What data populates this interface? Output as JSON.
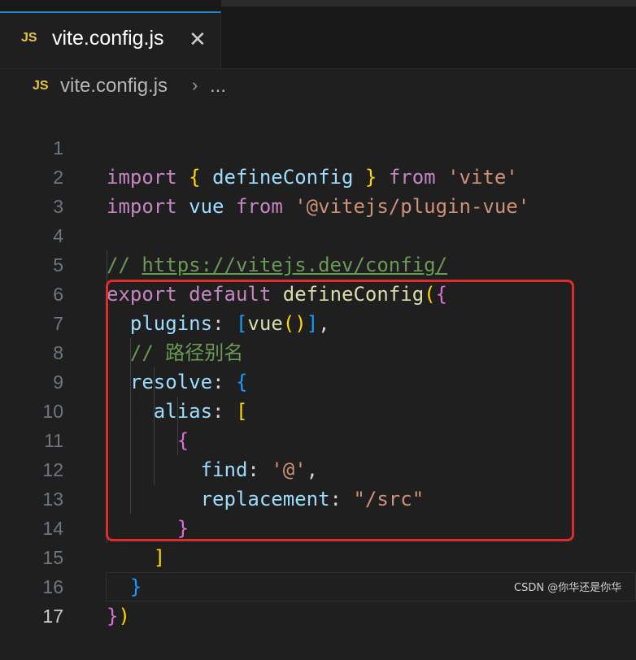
{
  "tab": {
    "icon": "JS",
    "title": "vite.config.js",
    "close": "✕"
  },
  "breadcrumb": {
    "icon": "JS",
    "file": "vite.config.js",
    "separator": "›",
    "more": "..."
  },
  "line_numbers": [
    "1",
    "2",
    "3",
    "4",
    "5",
    "6",
    "7",
    "8",
    "9",
    "10",
    "11",
    "12",
    "13",
    "14",
    "15",
    "16",
    "17"
  ],
  "active_line": "17",
  "code": {
    "l1": {
      "import": "import",
      "brace_open": "{",
      "name": "defineConfig",
      "brace_close": "}",
      "from": "from",
      "source": "'vite'"
    },
    "l2": {
      "import": "import",
      "name": "vue",
      "from": "from",
      "source": "'@vitejs/plugin-vue'"
    },
    "l4": {
      "slashes": "//",
      "url": "https://vitejs.dev/config/"
    },
    "l5": {
      "export": "export",
      "default": "default",
      "fn": "defineConfig",
      "paren": "(",
      "brace": "{"
    },
    "l6": {
      "key": "plugins",
      "colon": ":",
      "bracket_open": "[",
      "fn": "vue",
      "paren_open": "(",
      "paren_close": ")",
      "bracket_close": "]",
      "comma": ","
    },
    "l7": {
      "comment": "// 路径别名"
    },
    "l8": {
      "key": "resolve",
      "colon": ":",
      "brace": "{"
    },
    "l9": {
      "key": "alias",
      "colon": ":",
      "bracket": "["
    },
    "l10": {
      "brace": "{"
    },
    "l11": {
      "key": "find",
      "colon": ":",
      "value": "'@'",
      "comma": ","
    },
    "l12": {
      "key": "replacement",
      "colon": ":",
      "value": "\"/src\""
    },
    "l13": {
      "brace": "}"
    },
    "l14": {
      "bracket": "]"
    },
    "l15": {
      "brace": "}"
    },
    "l16": {
      "brace": "}",
      "paren": ")"
    }
  },
  "watermark": "CSDN @你华还是你华",
  "colors": {
    "accent_tab": "#1f8ad2",
    "highlight_box": "#e02b2b",
    "keyword": "#c586c0",
    "function": "#dcdcaa",
    "string": "#ce9178",
    "comment": "#6a9955"
  }
}
